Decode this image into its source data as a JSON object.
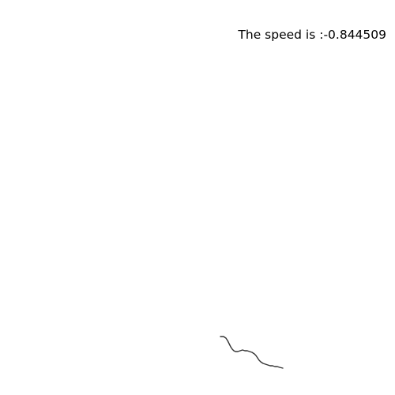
{
  "canvas": {
    "background": "#ffffff",
    "stroke_color": "#333333"
  },
  "readout": {
    "speed_text": "The speed is :-0.844509"
  }
}
